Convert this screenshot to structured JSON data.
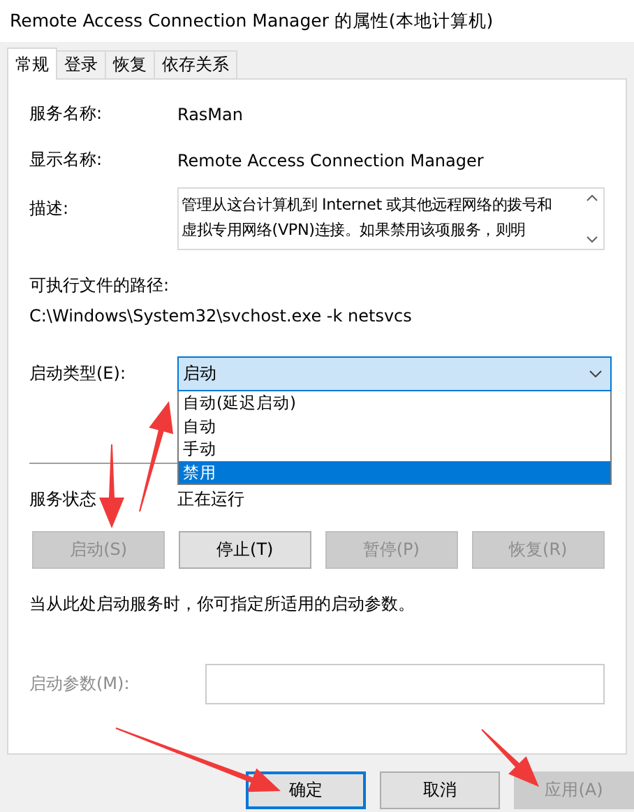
{
  "window": {
    "title": "Remote Access Connection Manager 的属性(本地计算机)"
  },
  "tabs": [
    {
      "label": "常规",
      "selected": true
    },
    {
      "label": "登录",
      "selected": false
    },
    {
      "label": "恢复",
      "selected": false
    },
    {
      "label": "依存关系",
      "selected": false
    }
  ],
  "service_name": {
    "label": "服务名称:",
    "value": "RasMan"
  },
  "display_name": {
    "label": "显示名称:",
    "value": "Remote Access Connection Manager"
  },
  "description": {
    "label": "描述:",
    "text": "管理从这台计算机到 Internet 或其他远程网络的拨号和虚拟专用网络(VPN)连接。如果禁用该项服务，则明"
  },
  "executable": {
    "label": "可执行文件的路径:",
    "path": "C:\\Windows\\System32\\svchost.exe -k netsvcs"
  },
  "startup_type": {
    "label": "启动类型(E):",
    "value": "启动",
    "expanded": true,
    "options": [
      {
        "label": "自动(延迟启动)",
        "selected": false
      },
      {
        "label": "自动",
        "selected": false
      },
      {
        "label": "手动",
        "selected": false
      },
      {
        "label": "禁用",
        "selected": true
      }
    ]
  },
  "service_status": {
    "label": "服务状态",
    "value": "正在运行"
  },
  "service_buttons": [
    {
      "label": "启动(S)",
      "disabled": true
    },
    {
      "label": "停止(T)",
      "disabled": false
    },
    {
      "label": "暂停(P)",
      "disabled": true
    },
    {
      "label": "恢复(R)",
      "disabled": true
    }
  ],
  "hint": "当从此处启动服务时，你可指定所适用的启动参数。",
  "start_params": {
    "label": "启动参数(M):",
    "disabled": true
  },
  "dialog_buttons": [
    {
      "label": "确定",
      "default": true,
      "disabled": false
    },
    {
      "label": "取消",
      "default": false,
      "disabled": false
    },
    {
      "label": "应用(A)",
      "default": false,
      "disabled": true
    }
  ]
}
